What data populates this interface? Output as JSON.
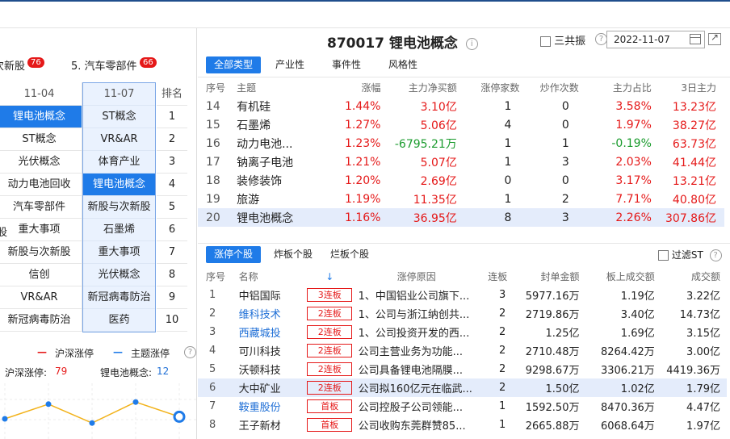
{
  "left": {
    "categories": [
      {
        "label": "次新股",
        "count": "76"
      },
      {
        "label": "5. 汽车零部件",
        "count": "66"
      }
    ],
    "headers": {
      "colA": "11-04",
      "colB": "11-07",
      "rank": "排名"
    },
    "colA": [
      "锂电池概念",
      "ST概念",
      "光伏概念",
      "动力电池回收",
      "汽车零部件",
      "重大事项",
      "新股与次新股",
      "信创",
      "VR&AR",
      "新冠病毒防治"
    ],
    "colA_highlight": 0,
    "colB": [
      "ST概念",
      "VR&AR",
      "体育产业",
      "锂电池概念",
      "新股与次新股",
      "石墨烯",
      "重大事项",
      "光伏概念",
      "新冠病毒防治",
      "医药"
    ],
    "colB_highlight": 3,
    "edge_labels": [
      "",
      "",
      "",
      "",
      "",
      "股",
      "",
      "",
      "",
      ""
    ],
    "ranks": [
      "1",
      "2",
      "3",
      "4",
      "5",
      "6",
      "7",
      "8",
      "9",
      "10"
    ],
    "legend": {
      "a": "沪深涨停",
      "b": "主题涨停"
    },
    "stats": {
      "a_label": "沪深涨停:",
      "a_value": "79",
      "b_label": "锂电池概念:",
      "b_value": "12"
    },
    "colors": {
      "red": "#e51919",
      "blue": "#1f7be8",
      "line": "#f2b21a"
    },
    "chart_data": {
      "type": "line",
      "series": [
        {
          "values": [
            40,
            47,
            38,
            48,
            41
          ]
        }
      ]
    }
  },
  "header": {
    "title": "870017 锂电池概念",
    "san_label": "三共振",
    "date": "2022-11-07"
  },
  "tabs": [
    "全部类型",
    "产业性",
    "事件性",
    "风格性"
  ],
  "theme_table": {
    "headers": [
      "序号",
      "主题",
      "涨幅",
      "主力净买额",
      "涨停家数",
      "炒作次数",
      "主力占比",
      "3日主力"
    ],
    "rows": [
      {
        "no": "14",
        "name": "有机硅",
        "chg": "1.44%",
        "net": "3.10亿",
        "limit": "1",
        "times": "0",
        "ratio": "3.58%",
        "d3": "13.23亿",
        "net_color": "red",
        "ratio_color": "red"
      },
      {
        "no": "15",
        "name": "石墨烯",
        "chg": "1.27%",
        "net": "5.06亿",
        "limit": "4",
        "times": "0",
        "ratio": "1.97%",
        "d3": "38.27亿",
        "net_color": "red",
        "ratio_color": "red"
      },
      {
        "no": "16",
        "name": "动力电池...",
        "chg": "1.23%",
        "net": "-6795.21万",
        "limit": "1",
        "times": "1",
        "ratio": "-0.19%",
        "d3": "63.73亿",
        "net_color": "green",
        "ratio_color": "green"
      },
      {
        "no": "17",
        "name": "钠离子电池",
        "chg": "1.21%",
        "net": "5.07亿",
        "limit": "1",
        "times": "3",
        "ratio": "2.03%",
        "d3": "41.44亿",
        "net_color": "red",
        "ratio_color": "red"
      },
      {
        "no": "18",
        "name": "装修装饰",
        "chg": "1.20%",
        "net": "2.69亿",
        "limit": "0",
        "times": "0",
        "ratio": "3.17%",
        "d3": "13.21亿",
        "net_color": "red",
        "ratio_color": "red"
      },
      {
        "no": "19",
        "name": "旅游",
        "chg": "1.19%",
        "net": "11.35亿",
        "limit": "1",
        "times": "2",
        "ratio": "7.71%",
        "d3": "40.80亿",
        "net_color": "red",
        "ratio_color": "red"
      },
      {
        "no": "20",
        "name": "锂电池概念",
        "chg": "1.16%",
        "net": "36.95亿",
        "limit": "8",
        "times": "3",
        "ratio": "2.26%",
        "d3": "307.86亿",
        "net_color": "red",
        "ratio_color": "red"
      }
    ],
    "selected": 6
  },
  "section_tabs": [
    "涨停个股",
    "炸板个股",
    "烂板个股"
  ],
  "filter_label": "过滤ST",
  "stock_table": {
    "headers": [
      "序号",
      "名称",
      "↓",
      "涨停原因",
      "连板",
      "封单金额",
      "板上成交额",
      "成交额"
    ],
    "rows": [
      {
        "no": "1",
        "name": "中铝国际",
        "tag": "3连板",
        "reason": "1、中国铝业公司旗下...",
        "lb": "3",
        "seal": "5977.16万",
        "board": "1.19亿",
        "amt": "3.22亿",
        "name_color": "default"
      },
      {
        "no": "2",
        "name": "维科技术",
        "tag": "2连板",
        "reason": "1、公司与浙江纳创共...",
        "lb": "2",
        "seal": "2719.86万",
        "board": "3.40亿",
        "amt": "14.73亿",
        "name_color": "blue"
      },
      {
        "no": "3",
        "name": "西藏城投",
        "tag": "2连板",
        "reason": "1、公司投资开发的西...",
        "lb": "2",
        "seal": "1.25亿",
        "board": "1.69亿",
        "amt": "3.15亿",
        "name_color": "blue"
      },
      {
        "no": "4",
        "name": "可川科技",
        "tag": "2连板",
        "reason": "公司主营业务为功能...",
        "lb": "2",
        "seal": "2710.48万",
        "board": "8264.42万",
        "amt": "3.00亿",
        "name_color": "default"
      },
      {
        "no": "5",
        "name": "沃顿科技",
        "tag": "2连板",
        "reason": "公司具备锂电池隔膜...",
        "lb": "2",
        "seal": "9298.67万",
        "board": "3306.21万",
        "amt": "4419.36万",
        "name_color": "default"
      },
      {
        "no": "6",
        "name": "大中矿业",
        "tag": "2连板",
        "reason": "公司拟160亿元在临武...",
        "lb": "2",
        "seal": "1.50亿",
        "board": "1.02亿",
        "amt": "1.79亿",
        "name_color": "default"
      },
      {
        "no": "7",
        "name": "鞍重股份",
        "tag": "首板",
        "reason": "公司控股子公司领能...",
        "lb": "1",
        "seal": "1592.50万",
        "board": "8470.36万",
        "amt": "4.47亿",
        "name_color": "blue"
      },
      {
        "no": "8",
        "name": "王子新材",
        "tag": "首板",
        "reason": "公司收购东莞群赞85...",
        "lb": "1",
        "seal": "2665.88万",
        "board": "6068.64万",
        "amt": "1.97亿",
        "name_color": "default"
      }
    ],
    "selected": 5
  }
}
